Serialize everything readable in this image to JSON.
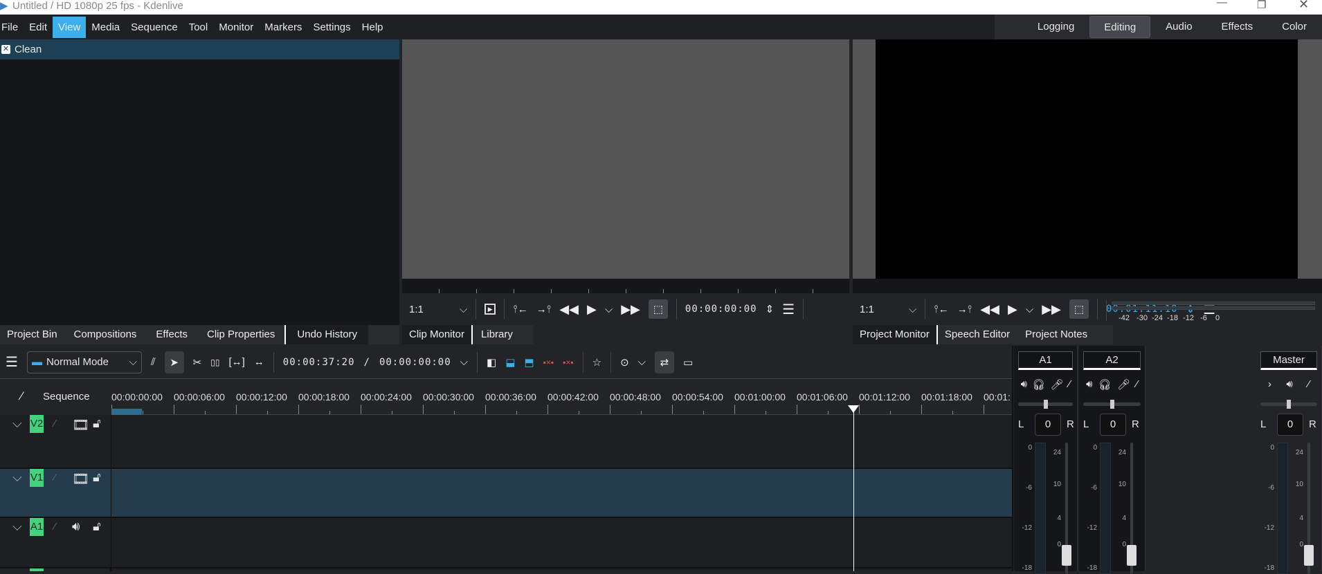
{
  "window": {
    "title": "Untitled / HD 1080p 25 fps - Kdenlive",
    "controls": [
      "minimize",
      "restore",
      "close"
    ]
  },
  "menu": [
    "File",
    "Edit",
    "View",
    "Media",
    "Sequence",
    "Tool",
    "Monitor",
    "Markers",
    "Settings",
    "Help"
  ],
  "menu_active": "View",
  "workspaces": [
    "Logging",
    "Editing",
    "Audio",
    "Effects",
    "Color"
  ],
  "workspace_active": "Editing",
  "undo_history": {
    "items": [
      {
        "label": "Clean"
      }
    ]
  },
  "left_tabs": [
    "Project Bin",
    "Compositions",
    "Effects",
    "Clip Properties",
    "Undo History"
  ],
  "left_tab_active": "Undo History",
  "clip_monitor": {
    "zoom": "1:1",
    "timecode": "00:00:00:00",
    "tabs": [
      "Clip Monitor",
      "Library"
    ],
    "tab_active": "Clip Monitor"
  },
  "project_monitor": {
    "zoom": "1:1",
    "timecode": "00:01:11:10",
    "tabs": [
      "Project Monitor",
      "Speech Editor",
      "Project Notes"
    ],
    "tab_active": "Project Monitor",
    "meter_scale": [
      "-42",
      "-30",
      "-24",
      "-18",
      "-12",
      "-6",
      "0"
    ]
  },
  "timeline_toolbar": {
    "mode": "Normal Mode",
    "position": "00:00:37:20",
    "separator": "/",
    "duration": "00:00:00:00"
  },
  "timeline": {
    "sequence_label": "Sequence",
    "ruler": [
      "00:00:00:00",
      "00:00:06:00",
      "00:00:12:00",
      "00:00:18:00",
      "00:00:24:00",
      "00:00:30:00",
      "00:00:36:00",
      "00:00:42:00",
      "00:00:48:00",
      "00:00:54:00",
      "00:01:00:00",
      "00:01:06:00",
      "00:01:12:00",
      "00:01:18:00",
      "00:01:"
    ],
    "tracks": [
      {
        "name": "V2",
        "type": "video"
      },
      {
        "name": "V1",
        "type": "video",
        "selected": true
      },
      {
        "name": "A1",
        "type": "audio"
      }
    ],
    "playhead": "00:01:11:10"
  },
  "mixer": {
    "channels": [
      {
        "name": "A1",
        "balance": "0"
      },
      {
        "name": "A2",
        "balance": "0"
      },
      {
        "name": "Master",
        "balance": "0"
      }
    ],
    "left": "L",
    "right": "R",
    "level_scale": [
      "0",
      "-6",
      "-12",
      "-18"
    ],
    "gain_scale": [
      "24",
      "10",
      "4",
      "0"
    ]
  },
  "colors": {
    "accent": "#3daee9",
    "track_badge": "#45d27f",
    "selected_track": "#243c4b",
    "timecode": "#3daee9"
  }
}
